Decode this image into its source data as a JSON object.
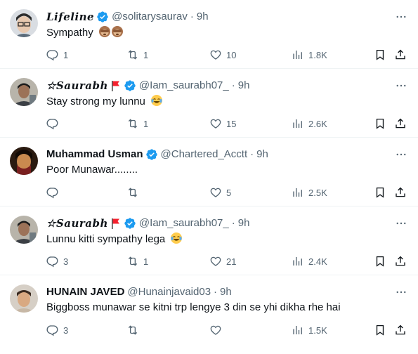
{
  "tweets": [
    {
      "name": "Lifeline",
      "handle": "@solitarysaurav",
      "time": "9h",
      "text": "Sympathy",
      "emoji": "see-no-evil-monkey x2",
      "replies": "1",
      "retweets": "1",
      "likes": "10",
      "views": "1.8K",
      "verified": true
    },
    {
      "name": "☆Saurabh",
      "handle": "@Iam_saurabh07_",
      "time": "9h",
      "text": "Stay strong my lunnu",
      "emoji": "face-with-tears-of-joy",
      "replies": "",
      "retweets": "1",
      "likes": "15",
      "views": "2.6K",
      "verified": true
    },
    {
      "name": "Muhammad Usman",
      "handle": "@Chartered_Acctt",
      "time": "9h",
      "text": "Poor Munawar........",
      "replies": "",
      "retweets": "",
      "likes": "5",
      "views": "2.5K",
      "verified": true
    },
    {
      "name": "☆Saurabh",
      "handle": "@Iam_saurabh07_",
      "time": "9h",
      "text": "Lunnu kitti sympathy lega",
      "emoji": "face-with-tears-of-joy",
      "replies": "3",
      "retweets": "1",
      "likes": "21",
      "views": "2.4K",
      "verified": true
    },
    {
      "name": "HUNAIN JAVED",
      "handle": "@Hunainjavaid03",
      "time": "9h",
      "text": "Biggboss munawar se kitni trp lengye 3 din se yhi dikha rhe hai",
      "replies": "3",
      "retweets": "",
      "likes": "",
      "views": "1.5K",
      "verified": false
    }
  ],
  "separator": "·",
  "colors": {
    "text_primary": "#0f1419",
    "text_secondary": "#536471",
    "verified_blue": "#1d9bf0",
    "flag_red": "#f4212e",
    "divider": "#eff3f4"
  },
  "icons": [
    "reply-icon",
    "retweet-icon",
    "like-icon",
    "views-icon",
    "bookmark-icon",
    "share-icon",
    "more-icon",
    "verified-badge-icon",
    "red-flag-icon"
  ]
}
